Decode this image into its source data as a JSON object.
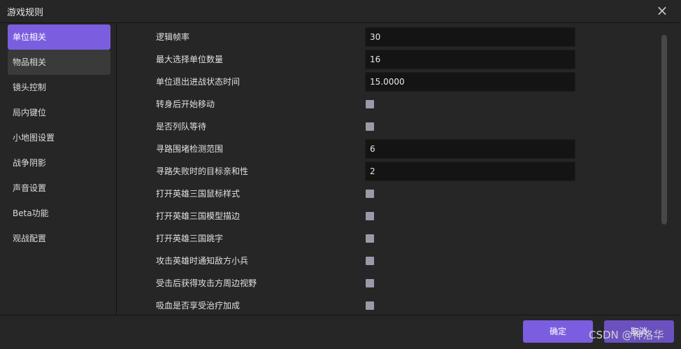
{
  "window": {
    "title": "游戏规则",
    "close_icon": "×"
  },
  "sidebar": {
    "items": [
      {
        "label": "单位相关",
        "state": "active"
      },
      {
        "label": "物品相关",
        "state": "hover"
      },
      {
        "label": "镜头控制",
        "state": ""
      },
      {
        "label": "局内键位",
        "state": ""
      },
      {
        "label": "小地图设置",
        "state": ""
      },
      {
        "label": "战争阴影",
        "state": ""
      },
      {
        "label": "声音设置",
        "state": ""
      },
      {
        "label": "Beta功能",
        "state": ""
      },
      {
        "label": "观战配置",
        "state": ""
      }
    ]
  },
  "settings": [
    {
      "label": "逻辑帧率",
      "type": "input",
      "value": "30"
    },
    {
      "label": "最大选择单位数量",
      "type": "input",
      "value": "16"
    },
    {
      "label": "单位退出进战状态时间",
      "type": "input",
      "value": "15.0000"
    },
    {
      "label": "转身后开始移动",
      "type": "checkbox",
      "checked": false
    },
    {
      "label": "是否列队等待",
      "type": "checkbox",
      "checked": false
    },
    {
      "label": "寻路围堵检测范围",
      "type": "input",
      "value": "6"
    },
    {
      "label": "寻路失败时的目标亲和性",
      "type": "input",
      "value": "2"
    },
    {
      "label": "打开英雄三国鼠标样式",
      "type": "checkbox",
      "checked": false
    },
    {
      "label": "打开英雄三国模型描边",
      "type": "checkbox",
      "checked": false
    },
    {
      "label": "打开英雄三国跳字",
      "type": "checkbox",
      "checked": false
    },
    {
      "label": "攻击英雄时通知敌方小兵",
      "type": "checkbox",
      "checked": false
    },
    {
      "label": "受击后获得攻击方周边视野",
      "type": "checkbox",
      "checked": false
    },
    {
      "label": "吸血是否享受治疗加成",
      "type": "checkbox",
      "checked": false
    }
  ],
  "footer": {
    "ok_label": "确定",
    "cancel_label": "取消"
  },
  "watermark": "CSDN @神洛华",
  "colors": {
    "accent": "#7b5ee0",
    "background": "#262626",
    "input_bg": "#141414",
    "checkbox": "#9a9aaa"
  }
}
